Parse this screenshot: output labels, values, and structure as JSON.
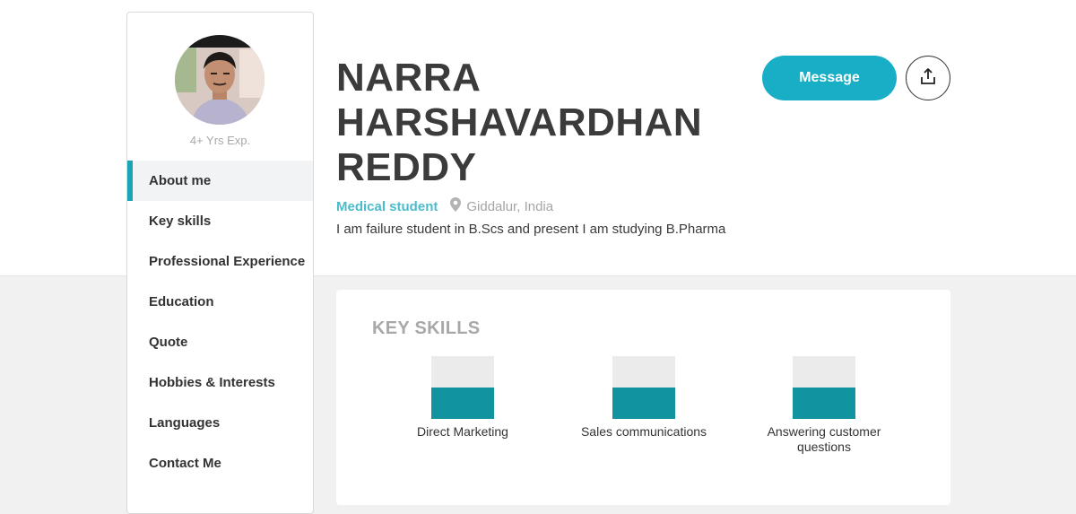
{
  "profile": {
    "experience": "4+ Yrs Exp.",
    "name_lines": [
      "NARRA",
      "HARSHAVARDHAN",
      "REDDY"
    ],
    "role": "Medical student",
    "location": "Giddalur, India",
    "bio": "I am failure student in B.Scs and present I am studying B.Pharma"
  },
  "sidebar": {
    "items": [
      {
        "label": "About me",
        "active": true
      },
      {
        "label": "Key skills"
      },
      {
        "label": "Professional Experience"
      },
      {
        "label": "Education"
      },
      {
        "label": "Quote"
      },
      {
        "label": "Hobbies & Interests"
      },
      {
        "label": "Languages"
      },
      {
        "label": "Contact Me"
      }
    ]
  },
  "actions": {
    "message_label": "Message",
    "share_icon": "share-icon"
  },
  "skills": {
    "title": "KEY SKILLS",
    "items": [
      {
        "label": "Direct Marketing",
        "level": 0.5
      },
      {
        "label": "Sales communications",
        "level": 0.5
      },
      {
        "label": "Answering customer questions",
        "level": 0.5
      }
    ]
  },
  "colors": {
    "accent": "#18afc6",
    "skill_fill": "#11949f",
    "role_text": "#4bbccb"
  }
}
